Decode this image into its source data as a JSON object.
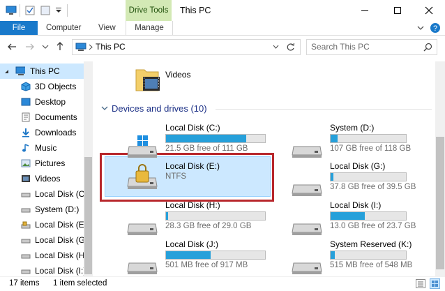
{
  "window": {
    "title": "This PC",
    "context_tab": "Drive Tools"
  },
  "ribbon": {
    "tabs": [
      "File",
      "Computer",
      "View",
      "Manage"
    ]
  },
  "address": {
    "path": "This PC",
    "search_placeholder": "Search This PC"
  },
  "nav": {
    "items": [
      {
        "label": "This PC",
        "icon": "computer-icon"
      },
      {
        "label": "3D Objects",
        "icon": "cube-icon"
      },
      {
        "label": "Desktop",
        "icon": "desktop-folder-icon"
      },
      {
        "label": "Documents",
        "icon": "documents-folder-icon"
      },
      {
        "label": "Downloads",
        "icon": "download-arrow-icon"
      },
      {
        "label": "Music",
        "icon": "music-note-icon"
      },
      {
        "label": "Pictures",
        "icon": "pictures-folder-icon"
      },
      {
        "label": "Videos",
        "icon": "videos-folder-icon"
      },
      {
        "label": "Local Disk (C:)",
        "icon": "drive-icon"
      },
      {
        "label": "System (D:)",
        "icon": "drive-icon"
      },
      {
        "label": "Local Disk (E:)",
        "icon": "locked-drive-icon"
      },
      {
        "label": "Local Disk (G:)",
        "icon": "drive-icon"
      },
      {
        "label": "Local Disk (H:)",
        "icon": "drive-icon"
      },
      {
        "label": "Local Disk (I:)",
        "icon": "drive-icon"
      }
    ]
  },
  "content": {
    "folder": {
      "label": "Videos"
    },
    "group_header": "Devices and drives (10)",
    "drives": [
      {
        "name": "Local Disk (C:)",
        "free": "21.5 GB free of 111 GB",
        "used_fraction": 0.81,
        "icon": "windows-drive-icon"
      },
      {
        "name": "System (D:)",
        "free": "107 GB free of 118 GB",
        "used_fraction": 0.09,
        "icon": "drive-icon"
      },
      {
        "name": "Local Disk (E:)",
        "free": "NTFS",
        "used_fraction": null,
        "icon": "locked-drive-icon"
      },
      {
        "name": "Local Disk (G:)",
        "free": "37.8 GB free of 39.5 GB",
        "used_fraction": 0.04,
        "icon": "drive-icon"
      },
      {
        "name": "Local Disk (H:)",
        "free": "28.3 GB free of 29.0 GB",
        "used_fraction": 0.02,
        "icon": "drive-icon"
      },
      {
        "name": "Local Disk (I:)",
        "free": "13.0 GB free of 23.7 GB",
        "used_fraction": 0.45,
        "icon": "drive-icon"
      },
      {
        "name": "Local Disk (J:)",
        "free": "501 MB free of 917 MB",
        "used_fraction": 0.45,
        "icon": "drive-icon"
      },
      {
        "name": "System Reserved (K:)",
        "free": "515 MB free of 548 MB",
        "used_fraction": 0.06,
        "icon": "drive-icon"
      }
    ]
  },
  "status": {
    "items": "17 items",
    "selected": "1 item selected"
  },
  "colors": {
    "accent": "#1979ca",
    "selection": "#cce8ff",
    "bar_fill": "#26a0da",
    "highlight_box": "#b8272c",
    "drive_tools_tab": "#d3e9b5"
  }
}
